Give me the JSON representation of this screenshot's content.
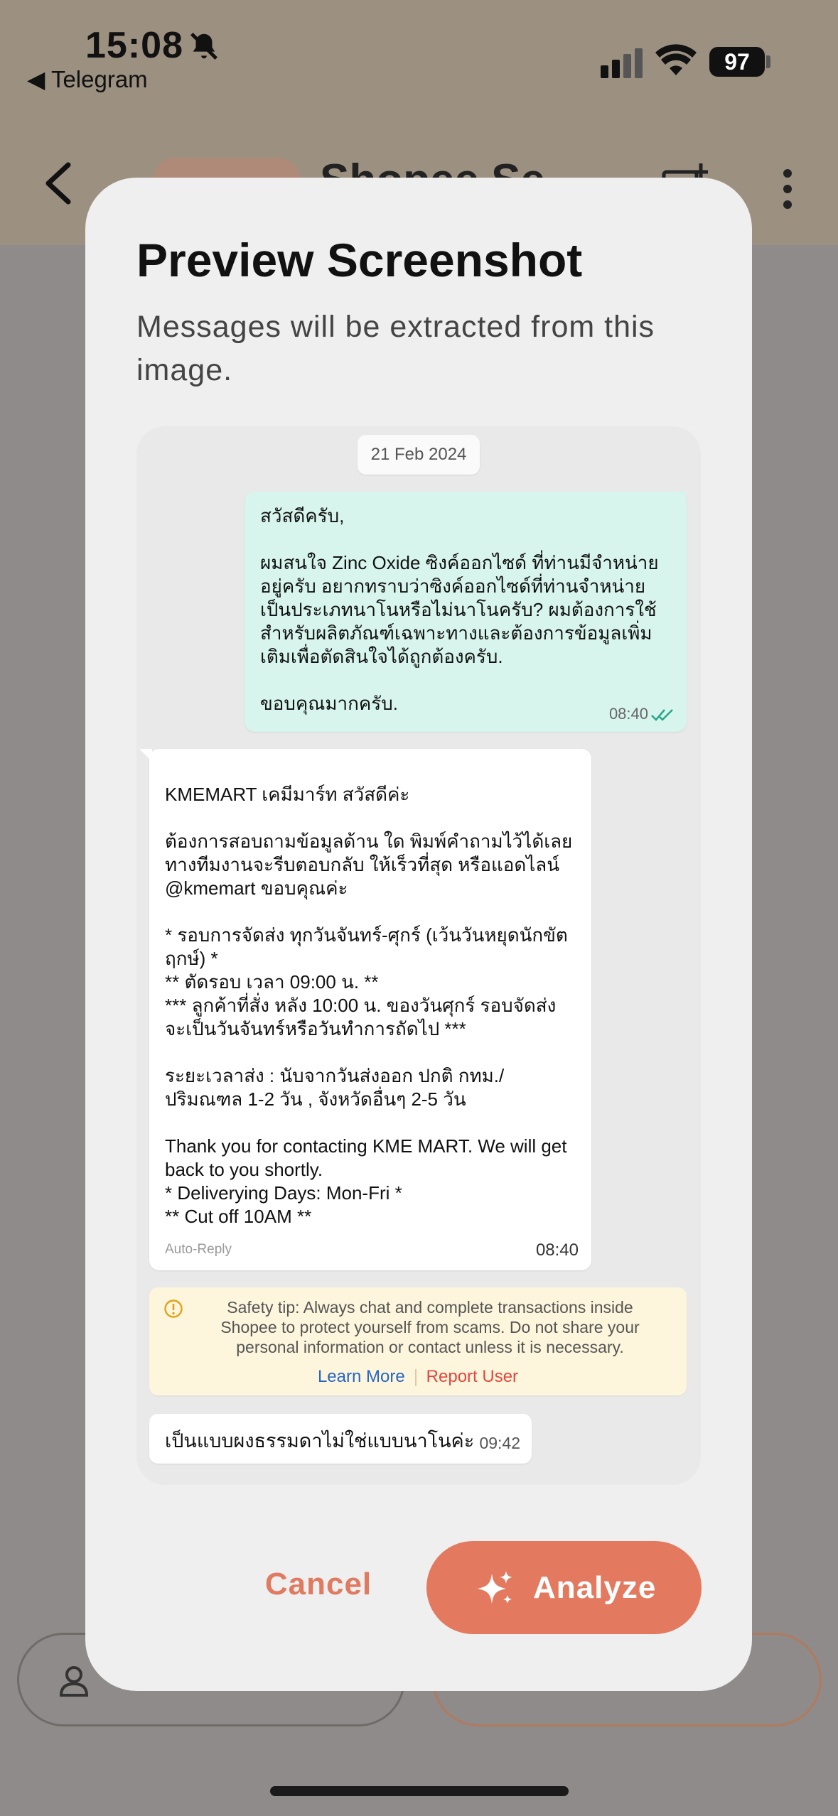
{
  "status_bar": {
    "time": "15:08",
    "back_app": "◀ Telegram",
    "battery": "97"
  },
  "background_chat": {
    "title": "Shopee Se"
  },
  "modal": {
    "title": "Preview Screenshot",
    "subtitle": "Messages will be extracted from this image.",
    "cancel_label": "Cancel",
    "analyze_label": "Analyze"
  },
  "preview": {
    "date": "21 Feb 2024",
    "outgoing": {
      "text": "สวัสดีครับ,\n\nผมสนใจ Zinc Oxide ซิงค์ออกไซด์ ที่ท่านมีจำหน่ายอยู่ครับ อยากทราบว่าซิงค์ออกไซด์ที่ท่านจำหน่ายเป็นประเภทนาโนหรือไม่นาโนครับ? ผมต้องการใช้สำหรับผลิตภัณฑ์เฉพาะทางและต้องการข้อมูลเพิ่มเติมเพื่อตัดสินใจได้ถูกต้องครับ.\n\nขอบคุณมากครับ.",
      "time": "08:40"
    },
    "incoming": {
      "text": "KMEMART เคมีมาร์ท สวัสดีค่ะ\n\nต้องการสอบถามข้อมูลด้าน ใด พิมพ์คำถามไว้ได้เลย ทางทีมงานจะรีบตอบกลับ ให้เร็วที่สุด หรือแอดไลน์ @kmemart ขอบคุณค่ะ\n\n* รอบการจัดส่ง ทุกวันจันทร์-ศุกร์ (เว้นวันหยุดนักขัตฤกษ์) *\n** ตัดรอบ เวลา 09:00 น. **\n*** ลูกค้าที่สั่ง หลัง 10:00 น. ของวันศุกร์ รอบจัดส่งจะเป็นวันจันทร์หรือวันทำการถัดไป ***\n\nระยะเวลาส่ง : นับจากวันส่งออก ปกติ กทม./ปริมณฑล 1-2 วัน , จังหวัดอื่นๆ 2-5 วัน\n\nThank you for contacting KME MART. We will get back to you shortly.\n* Deliverying Days: Mon-Fri *\n** Cut off 10AM **",
      "auto_reply": "Auto-Reply",
      "time": "08:40"
    },
    "safety_tip": {
      "text": "Safety tip: Always chat and complete transactions inside Shopee to protect yourself from scams. Do not share your personal information or contact unless it is necessary.",
      "learn_more": "Learn More",
      "report_user": "Report User"
    },
    "reply": {
      "text": "เป็นแบบผงธรรมดาไม่ใช่แบบนาโนค่ะ",
      "time": "09:42"
    }
  }
}
